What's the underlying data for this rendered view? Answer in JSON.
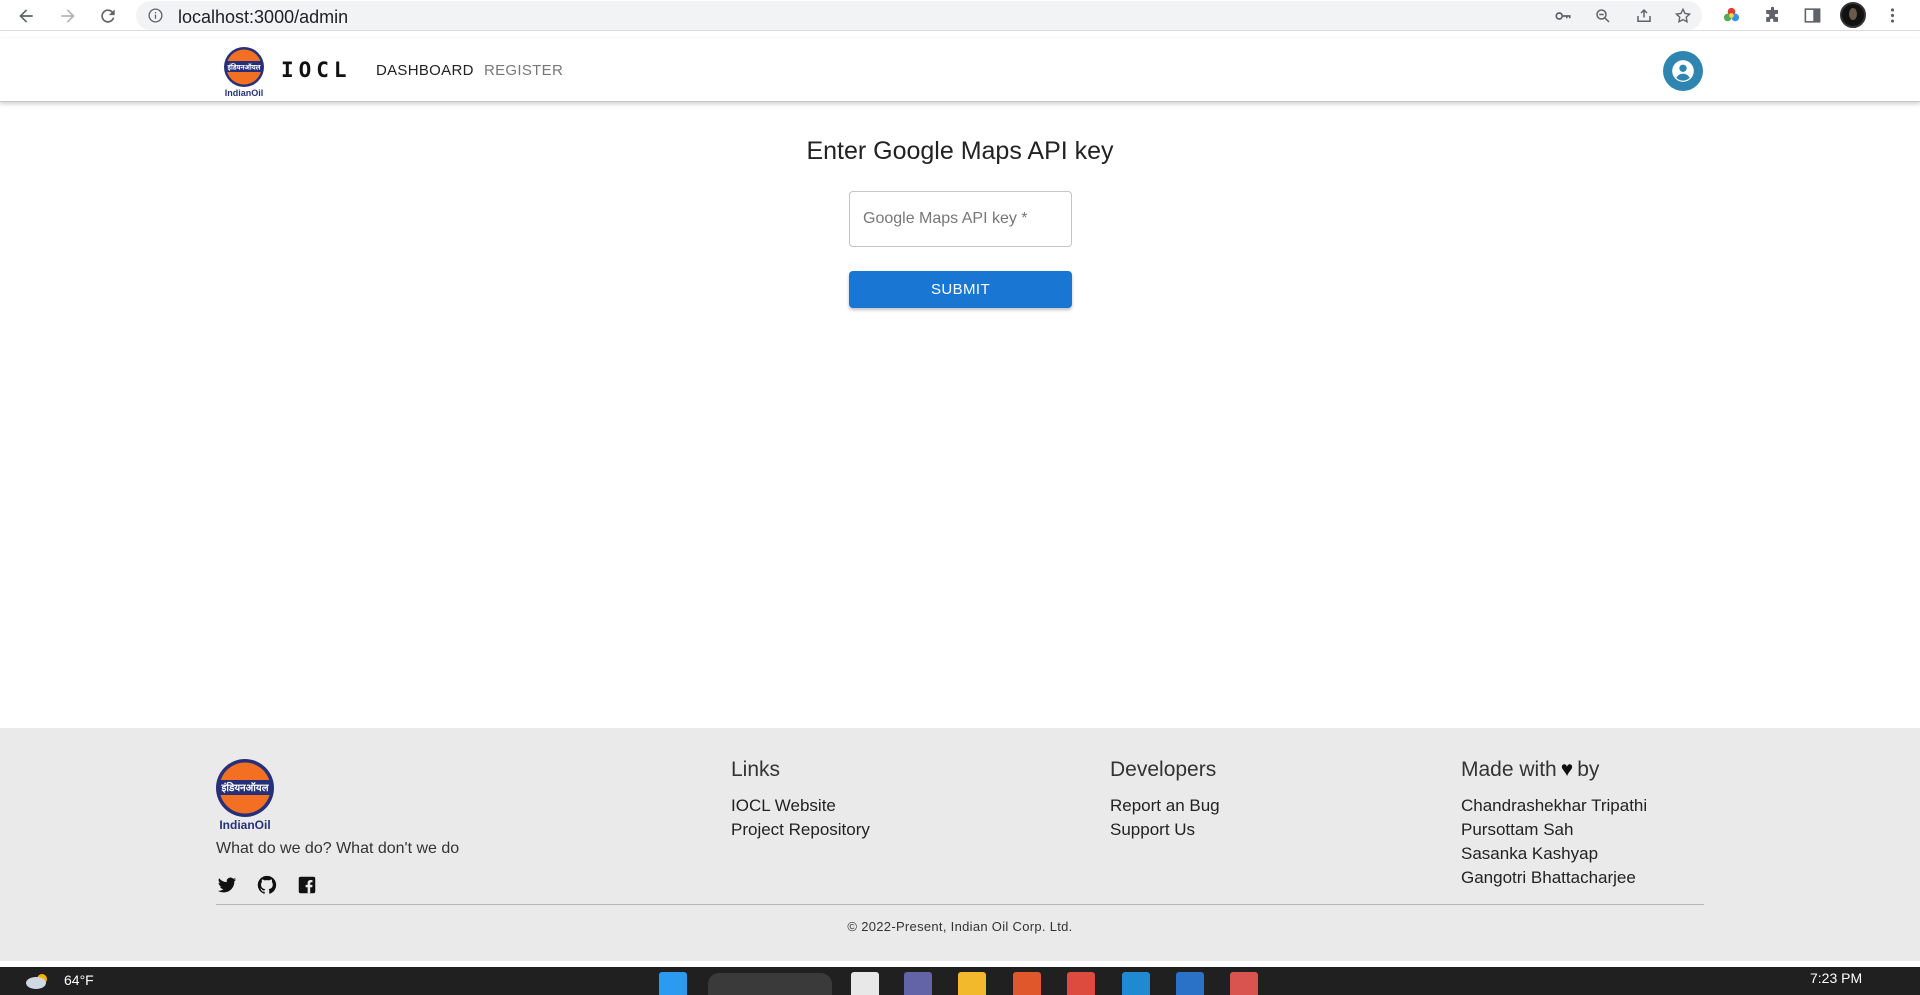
{
  "browser": {
    "url": "localhost:3000/admin",
    "back_icon": "arrow-left-icon",
    "forward_icon": "arrow-right-icon",
    "reload_icon": "reload-icon"
  },
  "header": {
    "logo_caption": "IndianOil",
    "logo_hindi": "इंडियनऑयल",
    "brand": "IOCL",
    "nav": [
      {
        "label": "DASHBOARD"
      },
      {
        "label": "REGISTER"
      }
    ]
  },
  "main": {
    "title": "Enter Google Maps API key",
    "input_placeholder": "Google Maps API key *",
    "submit_label": "SUBMIT"
  },
  "footer": {
    "logo_caption": "IndianOil",
    "logo_hindi": "इंडियनऑयल",
    "tagline": "What do we do? What don't we do",
    "links": {
      "title": "Links",
      "items": [
        "IOCL Website",
        "Project Repository"
      ]
    },
    "developers": {
      "title": "Developers",
      "items": [
        "Report an Bug",
        "Support Us"
      ]
    },
    "made_with": {
      "title_before": "Made with",
      "title_after": "by",
      "items": [
        "Chandrashekhar Tripathi",
        "Pursottam Sah",
        "Sasanka Kashyap",
        "Gangotri Bhattacharjee"
      ]
    },
    "copyright": "© 2022-Present, Indian Oil Corp. Ltd."
  },
  "taskbar": {
    "temperature": "64°F",
    "time": "7:23 PM"
  },
  "colors": {
    "primary": "#1976d2",
    "brand_orange": "#f37022",
    "brand_navy": "#26307a",
    "account_button": "#2e86b0",
    "footer_bg": "#eaeaea"
  }
}
